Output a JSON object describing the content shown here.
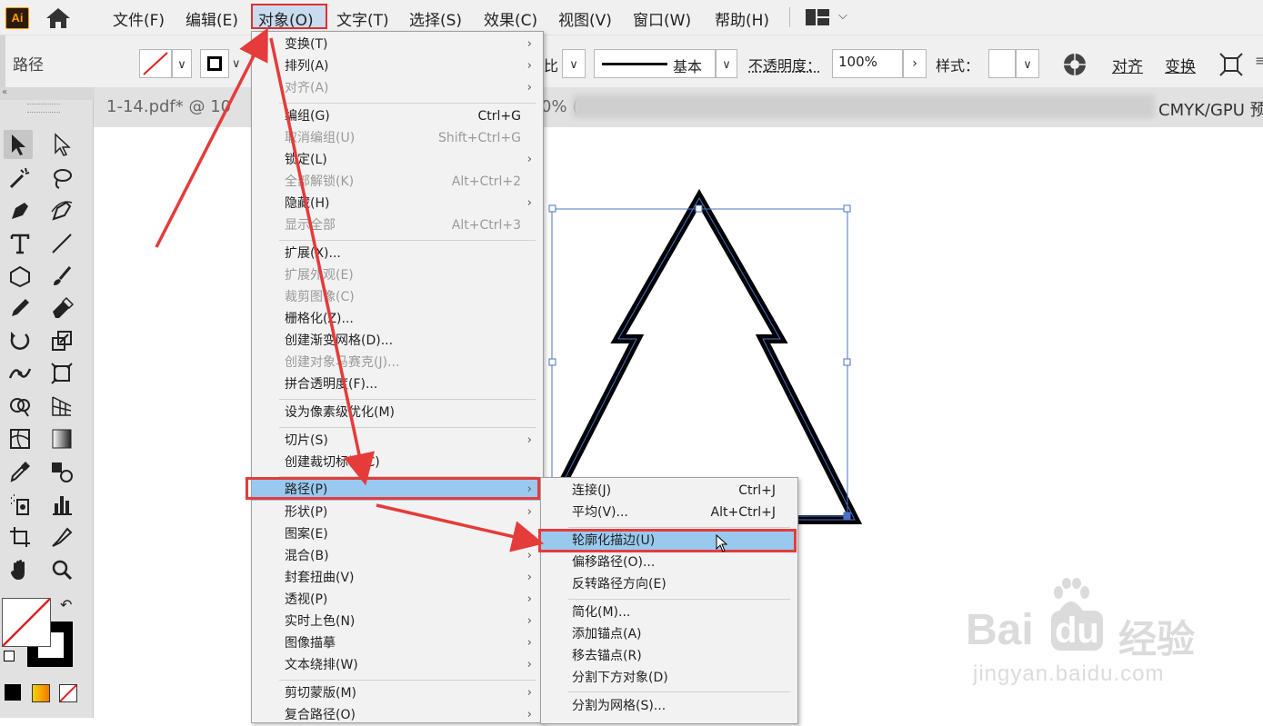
{
  "menubar": {
    "logo": "Ai",
    "items": [
      "文件(F)",
      "编辑(E)",
      "对象(O)",
      "文字(T)",
      "选择(S)",
      "效果(C)",
      "视图(V)",
      "窗口(W)",
      "帮助(H)"
    ]
  },
  "control": {
    "label": "路径",
    "stroke_profile_fragment": "比",
    "brush_label": "基本",
    "opacity_label": "不透明度：",
    "opacity_value": "100%",
    "style_label": "样式：",
    "align_label": "对齐",
    "transform_label": "变换"
  },
  "document": {
    "tab_title": "1-14.pdf* @ 10",
    "tab_mid": "0% (",
    "tab_right": "CMYK/GPU 预"
  },
  "object_menu": {
    "items": [
      {
        "label": "变换(T)",
        "shortcut": "",
        "submenu": true,
        "disabled": false
      },
      {
        "label": "排列(A)",
        "shortcut": "",
        "submenu": true,
        "disabled": false
      },
      {
        "label": "对齐(A)",
        "shortcut": "",
        "submenu": true,
        "disabled": true
      },
      {
        "label": "编组(G)",
        "shortcut": "Ctrl+G",
        "submenu": false,
        "disabled": false
      },
      {
        "label": "取消编组(U)",
        "shortcut": "Shift+Ctrl+G",
        "submenu": false,
        "disabled": true
      },
      {
        "label": "锁定(L)",
        "shortcut": "",
        "submenu": true,
        "disabled": false
      },
      {
        "label": "全部解锁(K)",
        "shortcut": "Alt+Ctrl+2",
        "submenu": false,
        "disabled": true
      },
      {
        "label": "隐藏(H)",
        "shortcut": "",
        "submenu": true,
        "disabled": false
      },
      {
        "label": "显示全部",
        "shortcut": "Alt+Ctrl+3",
        "submenu": false,
        "disabled": true
      },
      {
        "label": "扩展(X)...",
        "shortcut": "",
        "submenu": false,
        "disabled": false
      },
      {
        "label": "扩展外观(E)",
        "shortcut": "",
        "submenu": false,
        "disabled": true
      },
      {
        "label": "裁剪图像(C)",
        "shortcut": "",
        "submenu": false,
        "disabled": true
      },
      {
        "label": "栅格化(Z)...",
        "shortcut": "",
        "submenu": false,
        "disabled": false
      },
      {
        "label": "创建渐变网格(D)...",
        "shortcut": "",
        "submenu": false,
        "disabled": false
      },
      {
        "label": "创建对象马赛克(J)...",
        "shortcut": "",
        "submenu": false,
        "disabled": true
      },
      {
        "label": "拼合透明度(F)...",
        "shortcut": "",
        "submenu": false,
        "disabled": false
      },
      {
        "label": "设为像素级优化(M)",
        "shortcut": "",
        "submenu": false,
        "disabled": false
      },
      {
        "label": "切片(S)",
        "shortcut": "",
        "submenu": true,
        "disabled": false
      },
      {
        "label": "创建裁切标记(C)",
        "shortcut": "",
        "submenu": false,
        "disabled": false
      },
      {
        "label": "路径(P)",
        "shortcut": "",
        "submenu": true,
        "disabled": false
      },
      {
        "label": "形状(P)",
        "shortcut": "",
        "submenu": true,
        "disabled": false
      },
      {
        "label": "图案(E)",
        "shortcut": "",
        "submenu": true,
        "disabled": false
      },
      {
        "label": "混合(B)",
        "shortcut": "",
        "submenu": true,
        "disabled": false
      },
      {
        "label": "封套扭曲(V)",
        "shortcut": "",
        "submenu": true,
        "disabled": false
      },
      {
        "label": "透视(P)",
        "shortcut": "",
        "submenu": true,
        "disabled": false
      },
      {
        "label": "实时上色(N)",
        "shortcut": "",
        "submenu": true,
        "disabled": false
      },
      {
        "label": "图像描摹",
        "shortcut": "",
        "submenu": true,
        "disabled": false
      },
      {
        "label": "文本绕排(W)",
        "shortcut": "",
        "submenu": true,
        "disabled": false
      },
      {
        "label": "剪切蒙版(M)",
        "shortcut": "",
        "submenu": true,
        "disabled": false
      },
      {
        "label": "复合路径(O)",
        "shortcut": "",
        "submenu": true,
        "disabled": false
      }
    ]
  },
  "path_submenu": {
    "items": [
      {
        "label": "连接(J)",
        "shortcut": "Ctrl+J"
      },
      {
        "label": "平均(V)...",
        "shortcut": "Alt+Ctrl+J"
      },
      {
        "label": "轮廓化描边(U)",
        "shortcut": ""
      },
      {
        "label": "偏移路径(O)...",
        "shortcut": ""
      },
      {
        "label": "反转路径方向(E)",
        "shortcut": ""
      },
      {
        "label": "简化(M)...",
        "shortcut": ""
      },
      {
        "label": "添加锚点(A)",
        "shortcut": ""
      },
      {
        "label": "移去锚点(R)",
        "shortcut": ""
      },
      {
        "label": "分割下方对象(D)",
        "shortcut": ""
      },
      {
        "label": "分割为网格(S)...",
        "shortcut": ""
      }
    ]
  },
  "watermark": {
    "brand": "Bai",
    "brand2": "du",
    "cn": "经验",
    "url": "jingyan.baidu.com"
  },
  "colors": {
    "menu_highlight": "#99c9ef",
    "annotation_red": "#e53b3b",
    "selection_blue": "#4a73c8"
  }
}
